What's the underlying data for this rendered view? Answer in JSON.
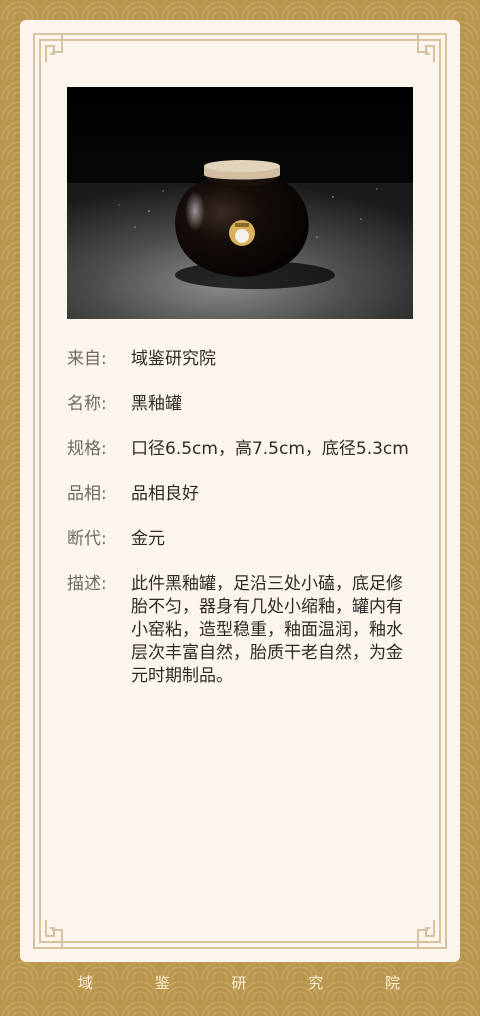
{
  "theme": {
    "background": "#b9974f",
    "card": "#fcf5ee",
    "frame_line": "#d8c3a0",
    "label_color": "#6d6a66",
    "value_color": "#2d2a27"
  },
  "item": {
    "image_alt": "黑釉罐",
    "fields": [
      {
        "label": "来自:",
        "value": "域鉴研究院"
      },
      {
        "label": "名称:",
        "value": "黑釉罐"
      },
      {
        "label": "规格:",
        "value": "口径6.5cm，高7.5cm，底径5.3cm"
      },
      {
        "label": "品相:",
        "value": "品相良好"
      },
      {
        "label": "断代:",
        "value": "金元"
      },
      {
        "label": "描述:",
        "value": "此件黑釉罐，足沿三处小磕，底足修胎不匀，器身有几处小缩釉，罐内有小窑粘，造型稳重，釉面温润，釉水层次丰富自然，胎质干老自然，为金元时期制品。"
      }
    ]
  },
  "footer": {
    "chars": [
      "域",
      "鉴",
      "研",
      "究",
      "院"
    ]
  }
}
